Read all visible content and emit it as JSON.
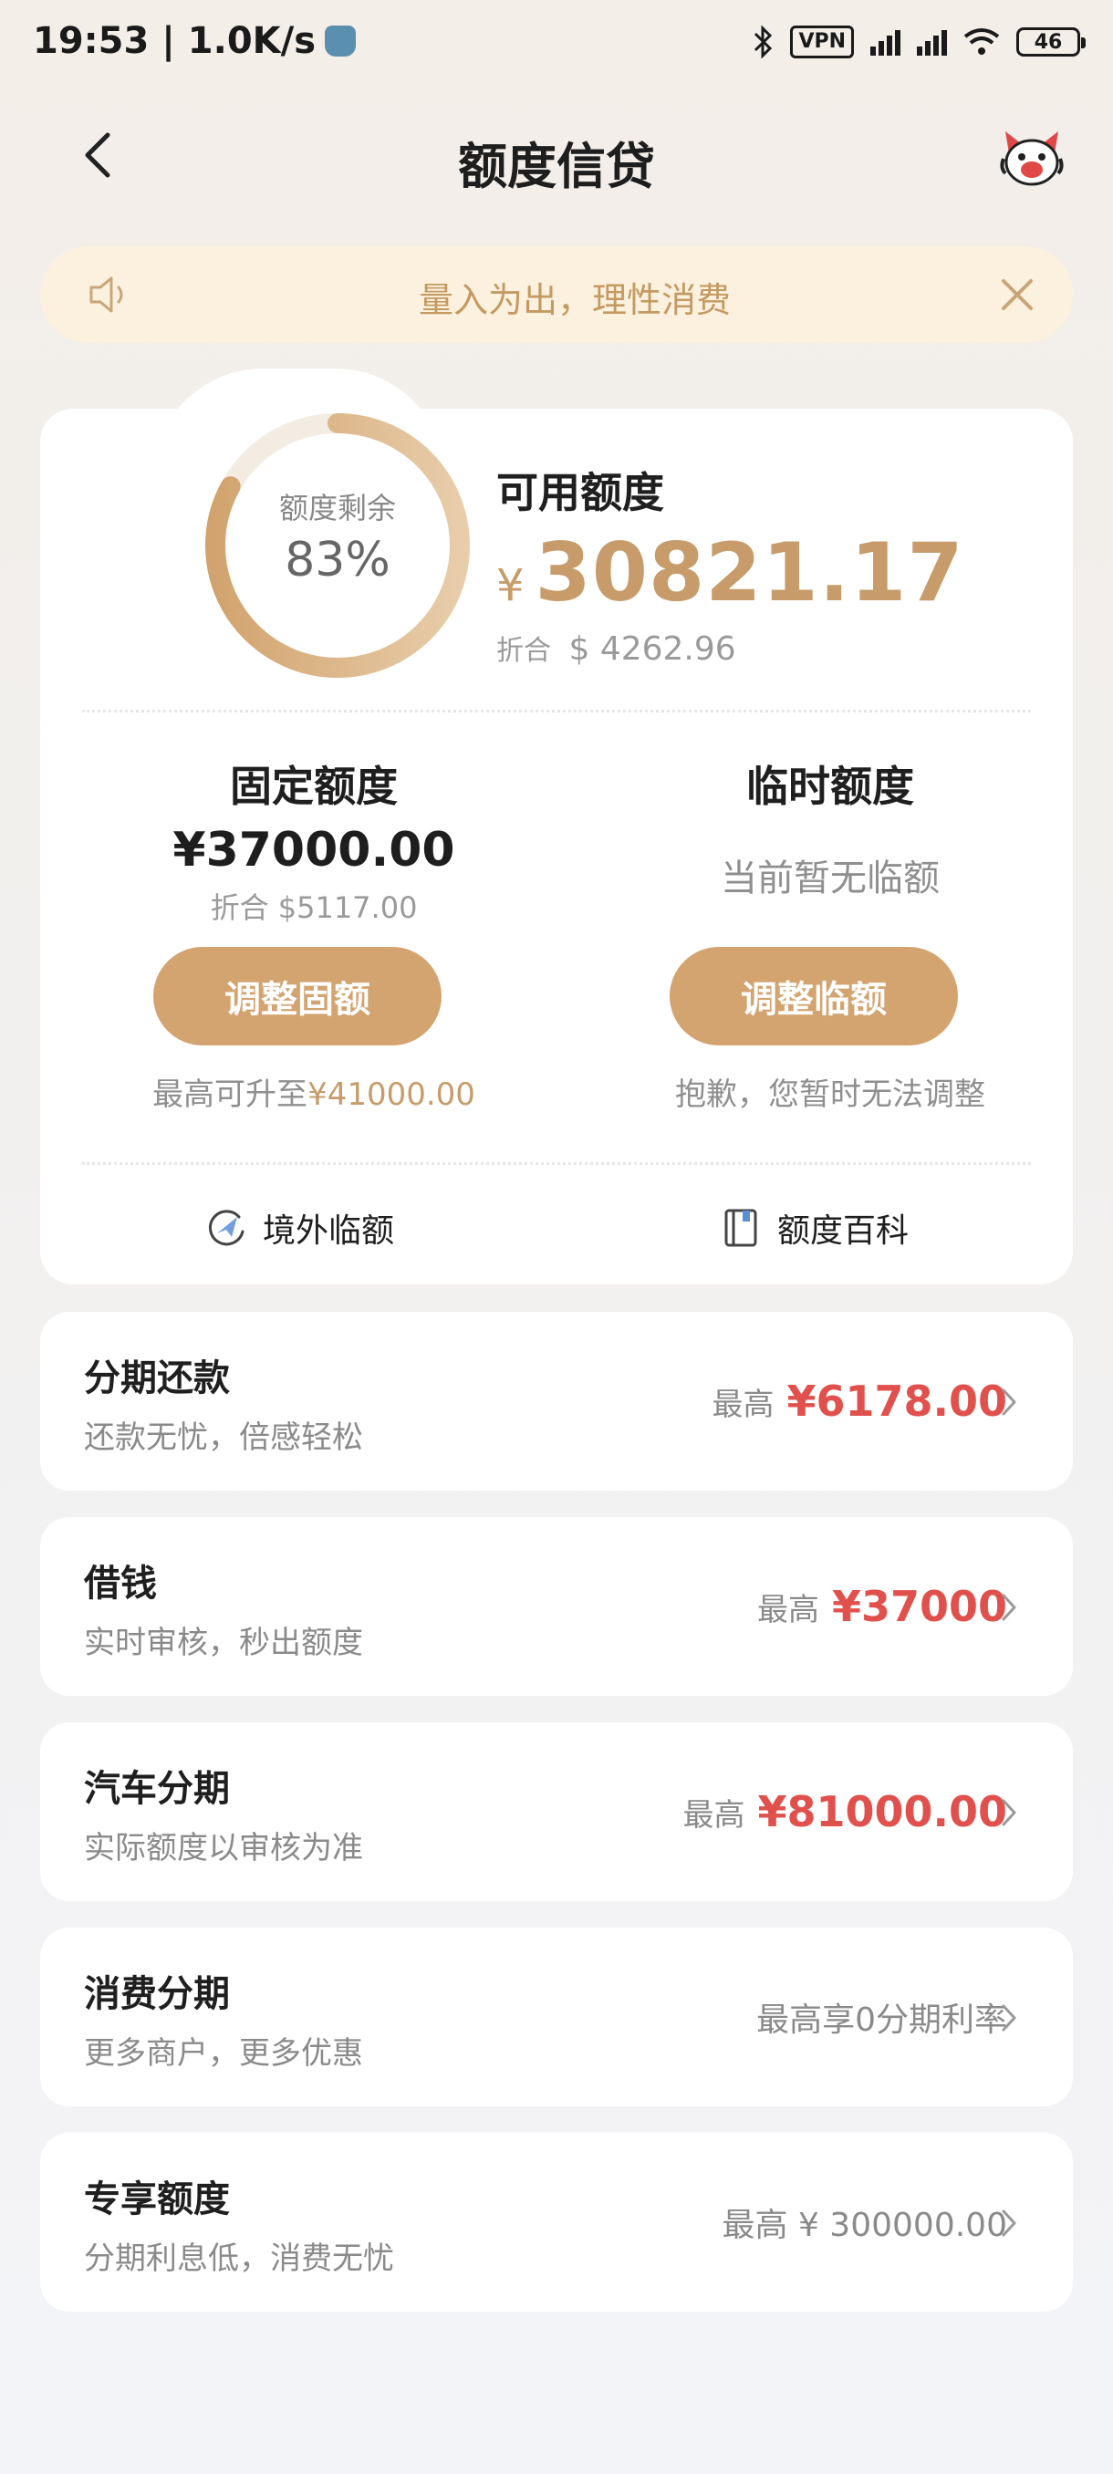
{
  "status_bar": {
    "time": "19:53 | 1.0K/s",
    "vpn": "VPN",
    "battery": "46"
  },
  "header": {
    "title": "额度信贷"
  },
  "notice": {
    "text": "量入为出，理性消费"
  },
  "summary": {
    "ring_label": "额度剩余",
    "ring_percent": "83%",
    "ring_fraction": 0.83,
    "available_title": "可用额度",
    "currency": "¥",
    "available_amount": "30821.17",
    "usd_prefix": "折合",
    "usd_symbol": "$",
    "usd_amount": "4262.96"
  },
  "fixed": {
    "title": "固定额度",
    "amount": "¥37000.00",
    "usd": "折合 $5117.00",
    "button": "调整固额",
    "note_prefix": "最高可升至",
    "note_value": "¥41000.00"
  },
  "temporary": {
    "title": "临时额度",
    "status": "当前暂无临额",
    "button": "调整临额",
    "note": "抱歉，您暂时无法调整"
  },
  "links": {
    "overseas": "境外临额",
    "wiki": "额度百科"
  },
  "rows": [
    {
      "title": "分期还款",
      "subtitle": "还款无忧，倍感轻松",
      "prefix": "最高",
      "value": "¥6178.00"
    },
    {
      "title": "借钱",
      "subtitle": "实时审核，秒出额度",
      "prefix": "最高",
      "value": "¥37000"
    },
    {
      "title": "汽车分期",
      "subtitle": "实际额度以审核为准",
      "prefix": "最高",
      "value": "¥81000.00"
    },
    {
      "title": "消费分期",
      "subtitle": "更多商户，更多优惠",
      "value": "最高享0分期利率"
    },
    {
      "title": "专享额度",
      "subtitle": "分期利息低，消费无忧",
      "value": "最高 ¥ 300000.00"
    }
  ],
  "colors": {
    "accent": "#d3a370",
    "accent_text": "#c79c6a",
    "highlight_red": "#e0514d",
    "notice_bg": "#fbf1de"
  }
}
